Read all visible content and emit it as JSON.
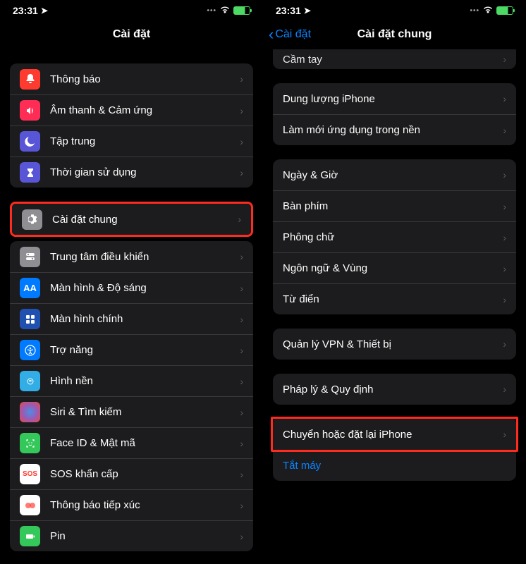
{
  "left": {
    "statusTime": "23:31",
    "title": "Cài đặt",
    "group1": [
      {
        "label": "Thông báo",
        "icon": "bell-icon",
        "color": "ic-red"
      },
      {
        "label": "Âm thanh & Cảm ứng",
        "icon": "sound-icon",
        "color": "ic-red2"
      },
      {
        "label": "Tập trung",
        "icon": "moon-icon",
        "color": "ic-purple"
      },
      {
        "label": "Thời gian sử dụng",
        "icon": "hourglass-icon",
        "color": "ic-purple2"
      }
    ],
    "group2": [
      {
        "label": "Cài đặt chung",
        "icon": "gear-icon",
        "color": "ic-gray",
        "highlight": true
      },
      {
        "label": "Trung tâm điều khiển",
        "icon": "toggles-icon",
        "color": "ic-gray2"
      },
      {
        "label": "Màn hình & Độ sáng",
        "icon": "text-size-icon",
        "color": "ic-blue"
      },
      {
        "label": "Màn hình chính",
        "icon": "grid-icon",
        "color": "ic-bluedk"
      },
      {
        "label": "Trợ năng",
        "icon": "accessibility-icon",
        "color": "ic-bluelt"
      },
      {
        "label": "Hình nền",
        "icon": "wallpaper-icon",
        "color": "ic-cyan"
      },
      {
        "label": "Siri & Tìm kiếm",
        "icon": "siri-icon",
        "color": "ic-black"
      },
      {
        "label": "Face ID & Mật mã",
        "icon": "face-id-icon",
        "color": "ic-green"
      },
      {
        "label": "SOS khẩn cấp",
        "icon": "sos-icon",
        "color": "ic-white"
      },
      {
        "label": "Thông báo tiếp xúc",
        "icon": "exposure-icon",
        "color": "ic-orange"
      },
      {
        "label": "Pin",
        "icon": "battery-icon",
        "color": "ic-green"
      }
    ]
  },
  "right": {
    "statusTime": "23:31",
    "backLabel": "Cài đặt",
    "title": "Cài đặt chung",
    "group1": [
      {
        "label": "Dung lượng iPhone"
      },
      {
        "label": "Làm mới ứng dụng trong nền"
      }
    ],
    "group2": [
      {
        "label": "Ngày & Giờ"
      },
      {
        "label": "Bàn phím"
      },
      {
        "label": "Phông chữ"
      },
      {
        "label": "Ngôn ngữ & Vùng"
      },
      {
        "label": "Từ điển"
      }
    ],
    "group3": [
      {
        "label": "Quản lý VPN & Thiết bị"
      }
    ],
    "group4": [
      {
        "label": "Pháp lý & Quy định"
      }
    ],
    "group5": [
      {
        "label": "Chuyển hoặc đặt lại iPhone",
        "highlight": true
      },
      {
        "label": "Tắt máy",
        "link": true
      }
    ],
    "hiddenTop": "Cầm tay"
  },
  "sosText": "SOS"
}
